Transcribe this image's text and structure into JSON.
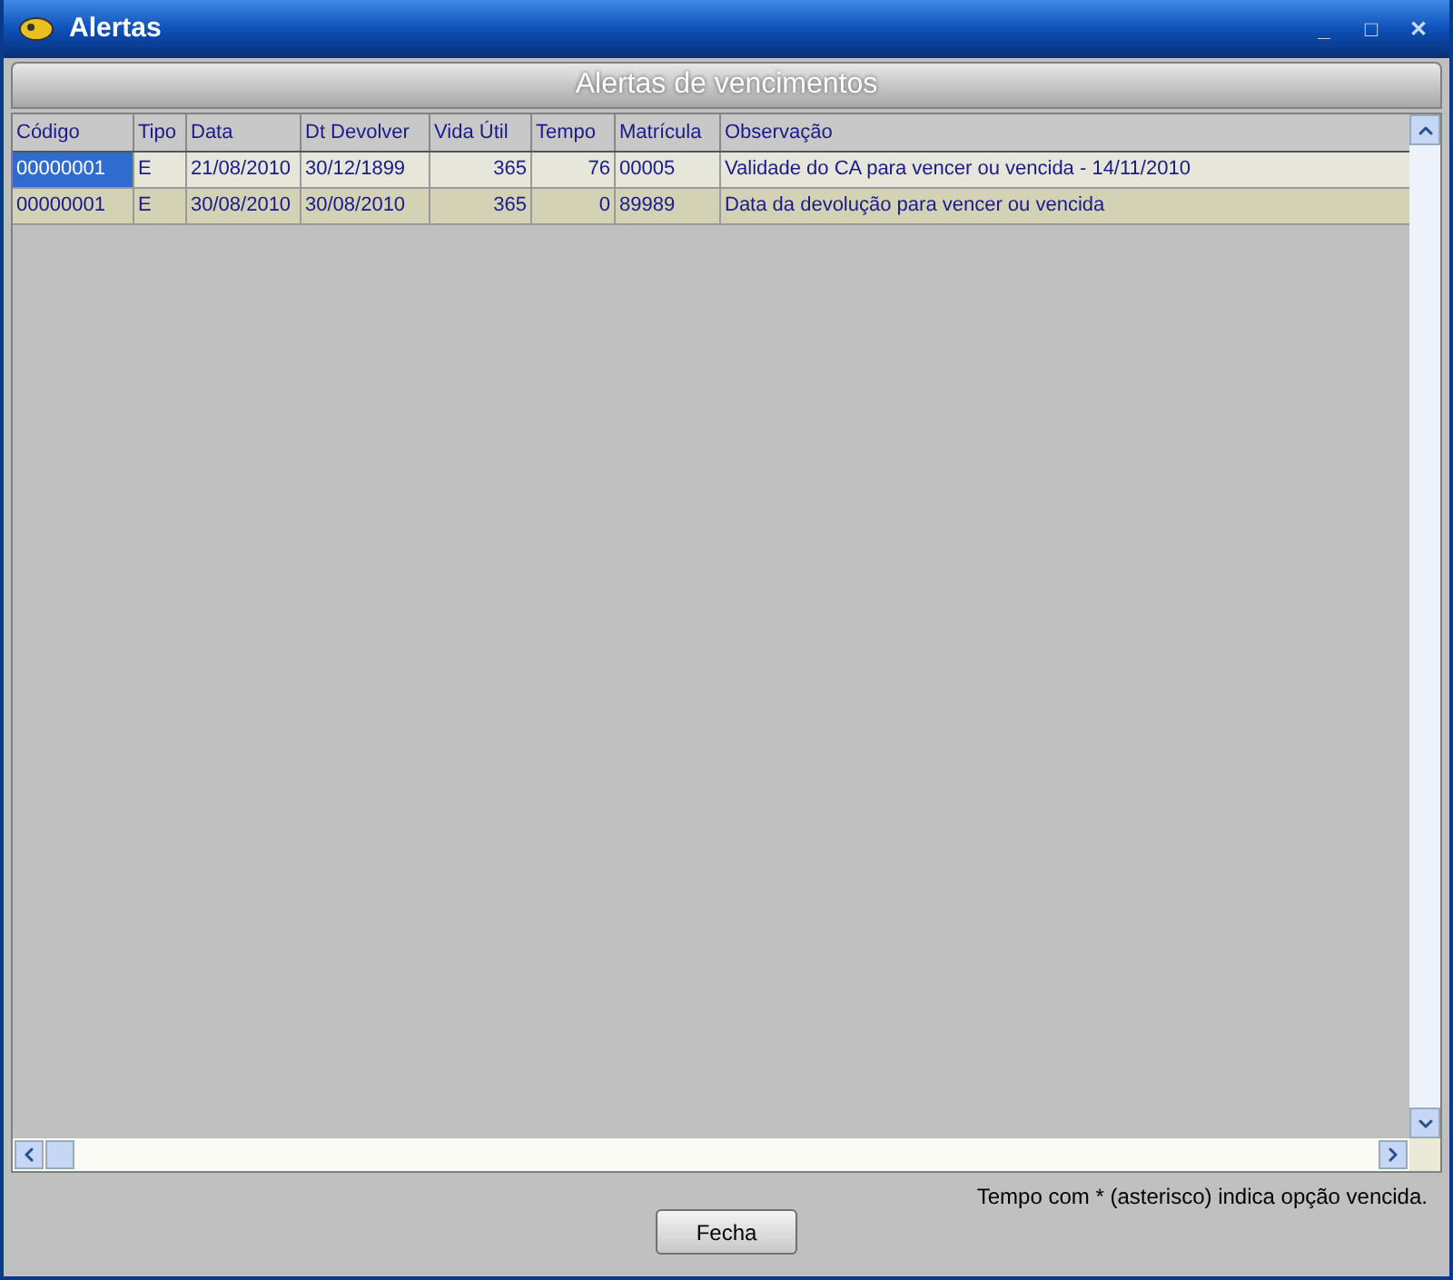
{
  "window": {
    "title": "Alertas",
    "controls": [
      "_",
      "□",
      "✕"
    ]
  },
  "header": "Alertas de vencimentos",
  "table": {
    "columns": [
      {
        "label": "Código",
        "kind": "text"
      },
      {
        "label": "Tipo",
        "kind": "text"
      },
      {
        "label": "Data",
        "kind": "text"
      },
      {
        "label": "Dt Devolver",
        "kind": "text"
      },
      {
        "label": "Vida Útil",
        "kind": "number"
      },
      {
        "label": "Tempo",
        "kind": "number"
      },
      {
        "label": "Matrícula",
        "kind": "text"
      },
      {
        "label": "Observação",
        "kind": "text"
      }
    ],
    "rows": [
      {
        "selected": true,
        "cells": [
          "00000001",
          "E",
          "21/08/2010",
          "30/12/1899",
          "365",
          "76",
          "00005",
          "Validade do CA para vencer ou vencida - 14/11/2010"
        ]
      },
      {
        "selected": false,
        "cells": [
          "00000001",
          "E",
          "30/08/2010",
          "30/08/2010",
          "365",
          "0",
          "89989",
          "Data da devolução para vencer ou vencida"
        ]
      }
    ]
  },
  "note": "Tempo com * (asterisco) indica opção vencida.",
  "buttons": [
    "Fecha"
  ]
}
